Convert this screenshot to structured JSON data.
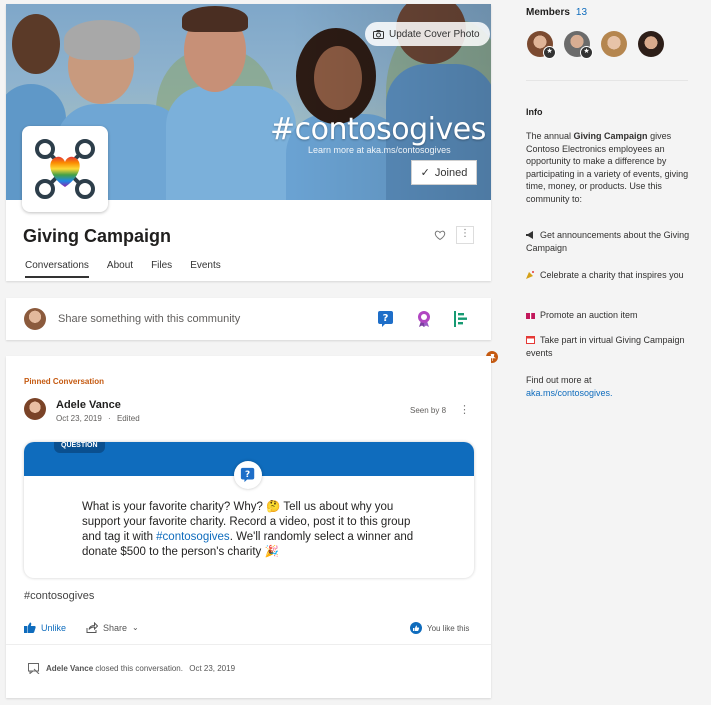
{
  "header": {
    "update_cover_label": "Update Cover Photo",
    "cover_hashtag": "#contosogives",
    "cover_learn_more": "Learn more at aka.ms/contosogives",
    "joined_label": "Joined",
    "community_title": "Giving Campaign",
    "tabs": [
      {
        "label": "Conversations",
        "active": true
      },
      {
        "label": "About"
      },
      {
        "label": "Files"
      },
      {
        "label": "Events"
      }
    ]
  },
  "composer": {
    "placeholder": "Share something with this community",
    "icons": [
      "question-icon",
      "praise-icon",
      "poll-icon"
    ]
  },
  "conversation": {
    "pinned_label": "Pinned Conversation",
    "author": "Adele Vance",
    "date": "Oct 23, 2019",
    "edited": "Edited",
    "seen_by": "Seen by 8",
    "question_badge": "QUESTION",
    "question_text_1": "What is your favorite charity? Why? 🤔 Tell us about why you support your favorite charity. Record a video, post it to this group and tag it with ",
    "question_hashtag": "#contosogives",
    "question_text_2": ". We'll randomly select a winner and donate $500 to the person's charity 🎉",
    "post_hashtag": "#contosogives",
    "unlike_label": "Unlike",
    "share_label": "Share",
    "you_like_label": "You like this",
    "closed_author": "Adele Vance",
    "closed_text": "closed this conversation.",
    "closed_date": "Oct 23, 2019"
  },
  "sidebar": {
    "members_label": "Members",
    "members_count": "13",
    "info_heading": "Info",
    "info_intro_1": "The annual ",
    "info_intro_bold": "Giving Campaign",
    "info_intro_2": " gives Contoso Electronics employees an opportunity to make a difference by participating in a variety of events, giving time, money, or products. Use this community to:",
    "items": [
      "Get announcements about the Giving Campaign",
      "Celebrate a charity that inspires you",
      "Promote an auction item",
      "Take part in virtual Giving Campaign events"
    ],
    "find_out": "Find out more at",
    "link": "aka.ms/contosogives."
  },
  "colors": {
    "accent": "#0f6cbd",
    "pinned": "#c55a11"
  }
}
